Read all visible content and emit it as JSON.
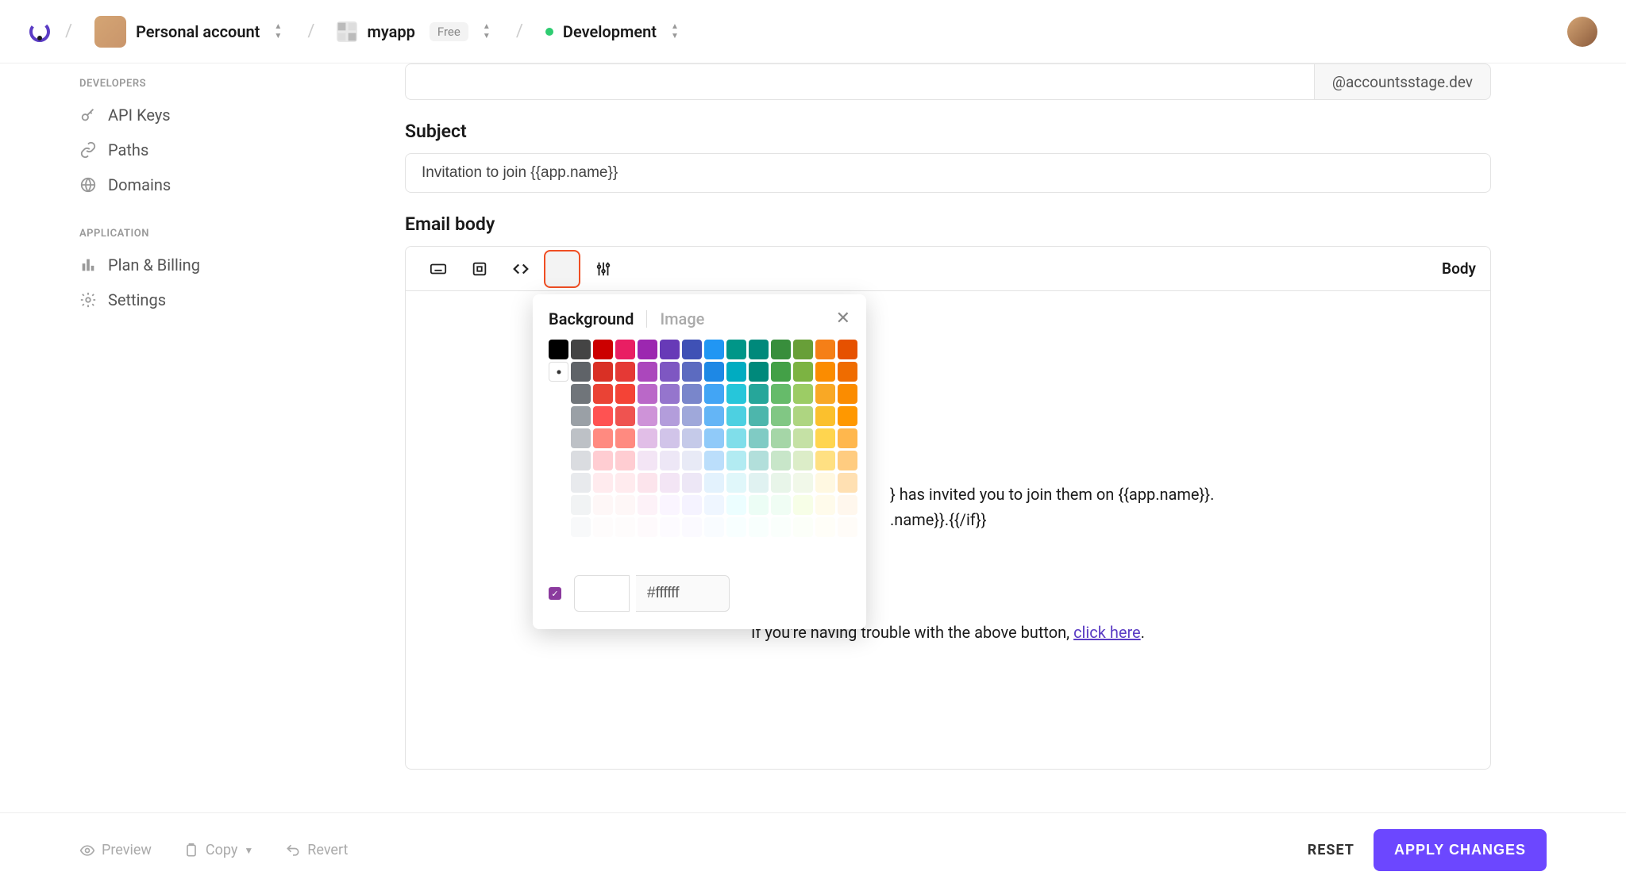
{
  "header": {
    "account_label": "Personal account",
    "app_name": "myapp",
    "plan_badge": "Free",
    "env_label": "Development"
  },
  "sidebar": {
    "heading_dev": "DEVELOPERS",
    "items_dev": [
      "API Keys",
      "Paths",
      "Domains"
    ],
    "heading_app": "APPLICATION",
    "items_app": [
      "Plan & Billing",
      "Settings"
    ]
  },
  "form": {
    "from_suffix": "@accountsstage.dev",
    "subject_label": "Subject",
    "subject_value": "Invitation to join {{app.name}}",
    "body_label": "Email body",
    "toolbar_right": "Body"
  },
  "popup": {
    "tab_bg": "Background",
    "tab_img": "Image",
    "hex_value": "#ffffff",
    "palette_rows": [
      [
        "#000000",
        "#444444",
        "#cc0000",
        "#e91e63",
        "#9c27b0",
        "#673ab7",
        "#3f51b5",
        "#2196f3",
        "#009688",
        "#00897b",
        "#388e3c",
        "#689f38",
        "#f57f17",
        "#e65100"
      ],
      [
        "#ffffff",
        "#5f6368",
        "#d93025",
        "#e53935",
        "#ab47bc",
        "#7e57c2",
        "#5c6bc0",
        "#1e88e5",
        "#00acc1",
        "#00897b",
        "#43a047",
        "#7cb342",
        "#fb8c00",
        "#ef6c00"
      ],
      [
        "#ffffff",
        "#70757a",
        "#ea4335",
        "#f44336",
        "#ba68c8",
        "#9575cd",
        "#7986cb",
        "#42a5f5",
        "#26c6da",
        "#26a69a",
        "#66bb6a",
        "#9ccc65",
        "#f9a825",
        "#fb8c00"
      ],
      [
        "#ffffff",
        "#9aa0a6",
        "#ff5252",
        "#ef5350",
        "#ce93d8",
        "#b39ddb",
        "#9fa8da",
        "#64b5f6",
        "#4dd0e1",
        "#4db6ac",
        "#81c784",
        "#aed581",
        "#fbc02d",
        "#ff9800"
      ],
      [
        "#ffffff",
        "#bdc1c6",
        "#ff8a80",
        "#ff8a80",
        "#e1bee7",
        "#d1c4e9",
        "#c5cae9",
        "#90caf9",
        "#80deea",
        "#80cbc4",
        "#a5d6a7",
        "#c5e1a5",
        "#ffd54f",
        "#ffb74d"
      ],
      [
        "#ffffff",
        "#dadce0",
        "#ffcdd2",
        "#ffcdd2",
        "#f3e5f5",
        "#ede7f6",
        "#e8eaf6",
        "#bbdefb",
        "#b2ebf2",
        "#b2dfdb",
        "#c8e6c9",
        "#dcedc8",
        "#ffe082",
        "#ffcc80"
      ],
      [
        "#ffffff",
        "#e8eaed",
        "#ffebee",
        "#ffebee",
        "#fce4ec",
        "#f3e5f5",
        "#ede7f6",
        "#e3f2fd",
        "#e0f7fa",
        "#e0f2f1",
        "#e8f5e9",
        "#f1f8e9",
        "#fff8e1",
        "#ffe0b2"
      ],
      [
        "#ffffff",
        "#f1f3f4",
        "#fef7f7",
        "#fef7f7",
        "#fdf2f8",
        "#faf5ff",
        "#f5f3ff",
        "#eff6ff",
        "#ecfeff",
        "#ecfdf5",
        "#f0fdf4",
        "#f7fee7",
        "#fffbeb",
        "#fff7ed"
      ],
      [
        "#ffffff",
        "#f8f9fa",
        "#fefcfc",
        "#fefcfc",
        "#fefafc",
        "#fdfbff",
        "#fbfaff",
        "#f9fcff",
        "#f8ffff",
        "#f8fffd",
        "#fafffc",
        "#fcfff9",
        "#fffef8",
        "#fffcf8"
      ],
      [
        "#ffffff",
        "#ffffff",
        "#ffffff",
        "#ffffff",
        "#ffffff",
        "#ffffff",
        "#ffffff",
        "#ffffff",
        "#ffffff",
        "#ffffff",
        "#ffffff",
        "#ffffff",
        "#ffffff",
        "#ffffff"
      ]
    ]
  },
  "preview": {
    "line1": "} has invited you to join them on {{app.name}}.",
    "line2": ".name}}.{{/if}}",
    "bottom_pre": "If you're having trouble with the above button, ",
    "bottom_link": "click here",
    "bottom_post": "."
  },
  "footer": {
    "preview": "Preview",
    "copy": "Copy",
    "revert": "Revert",
    "reset": "RESET",
    "apply": "APPLY CHANGES"
  }
}
